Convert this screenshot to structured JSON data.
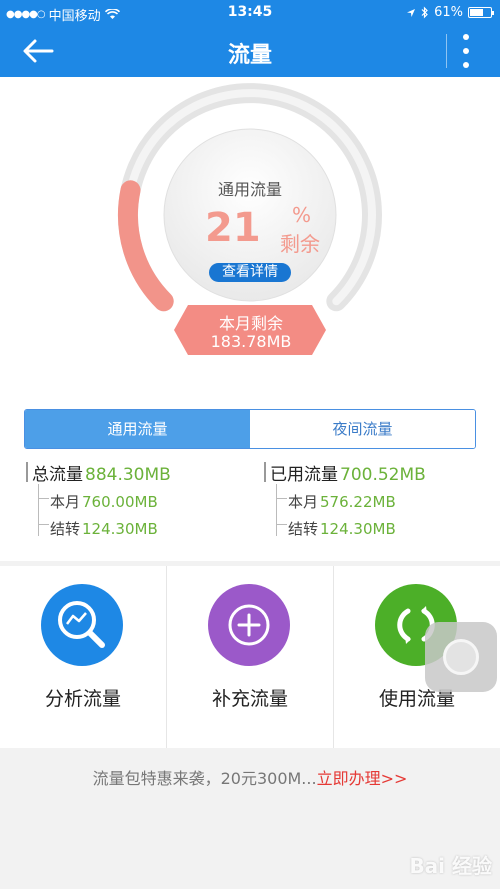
{
  "status": {
    "carrier": "中国移动",
    "time": "13:45",
    "battery": "61%"
  },
  "nav": {
    "title": "流量"
  },
  "gauge": {
    "title": "通用流量",
    "percent": "21",
    "percent_sign": "%",
    "remain_label": "剩余",
    "detail_button": "查看详情",
    "month_label": "本月剩余",
    "month_value": "183.78MB",
    "remaining_fraction": 0.21,
    "colors": {
      "used": "#e8e8e8",
      "remain": "#f2948a"
    }
  },
  "tabs": [
    {
      "label": "通用流量",
      "active": true
    },
    {
      "label": "夜间流量",
      "active": false
    }
  ],
  "stats": {
    "total": {
      "label": "总流量",
      "value": "884.30MB",
      "month_label": "本月",
      "month_value": "760.00MB",
      "carry_label": "结转",
      "carry_value": "124.30MB"
    },
    "used": {
      "label": "已用流量",
      "value": "700.52MB",
      "month_label": "本月",
      "month_value": "576.22MB",
      "carry_label": "结转",
      "carry_value": "124.30MB"
    }
  },
  "actions": [
    {
      "label": "分析流量",
      "icon": "magnifier-chart-icon",
      "color": "#1e88e5"
    },
    {
      "label": "补充流量",
      "icon": "plus-circle-icon",
      "color": "#9b59c9"
    },
    {
      "label": "使用流量",
      "icon": "refresh-arrows-icon",
      "color": "#4caf28"
    }
  ],
  "promo": {
    "text": "流量包特惠来袭，20元300M...",
    "link": "立即办理>>"
  },
  "watermark": "Bai 经验"
}
